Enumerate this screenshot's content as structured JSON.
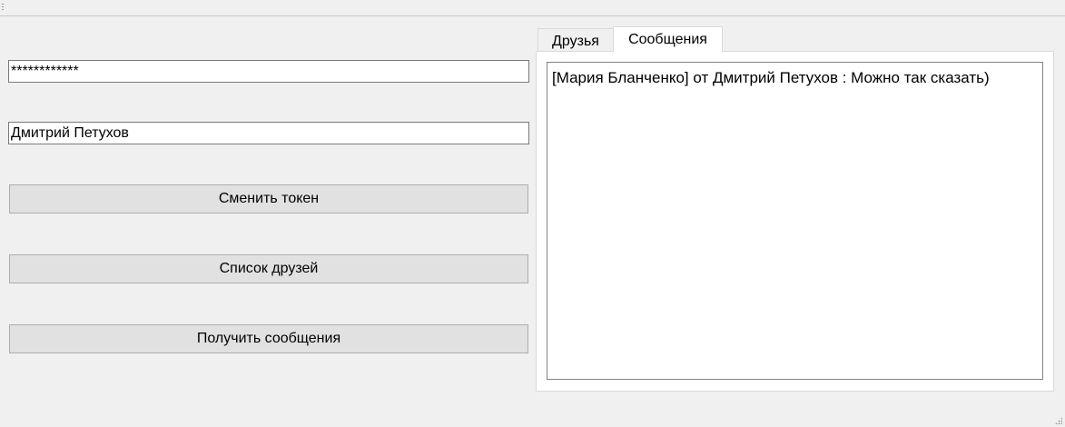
{
  "form": {
    "token_value": "************",
    "name_value": "Дмитрий Петухов",
    "change_token_label": "Сменить токен",
    "friends_list_label": "Список друзей",
    "get_messages_label": "Получить сообщения"
  },
  "tabs": [
    {
      "label": "Друзья",
      "active": false
    },
    {
      "label": "Сообщения",
      "active": true
    }
  ],
  "messages": [
    "[Мария Бланченко] от Дмитрий Петухов : Можно так сказать)"
  ],
  "icons": {
    "toolbar_grip": "grip-icon",
    "size_grip": "resize-grip-icon"
  },
  "colors": {
    "window_bg": "#f0f0f0",
    "button_bg": "#e1e1e1",
    "field_bg": "#ffffff"
  }
}
